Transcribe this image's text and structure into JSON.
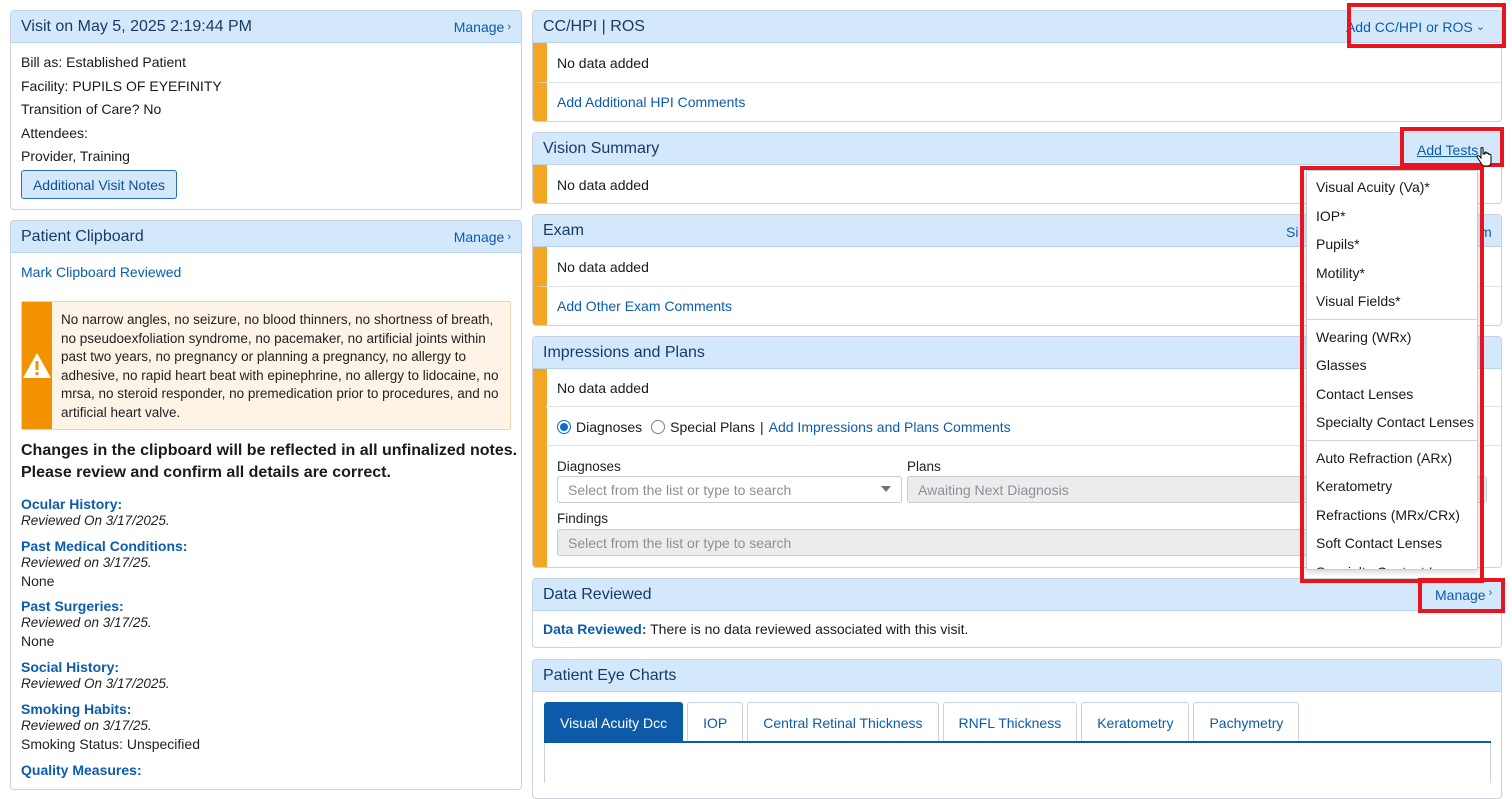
{
  "visit": {
    "title": "Visit on May 5, 2025 2:19:44 PM",
    "manage": "Manage",
    "bill_as": "Bill as: Established Patient",
    "facility": "Facility: PUPILS OF EYEFINITY",
    "transition": "Transition of Care? No",
    "attendees_label": "Attendees:",
    "attendees": "Provider, Training",
    "notes_button": "Additional Visit Notes"
  },
  "clipboard": {
    "title": "Patient Clipboard",
    "manage": "Manage",
    "mark_reviewed": "Mark Clipboard Reviewed",
    "alert": "No narrow angles, no seizure, no blood thinners, no shortness of breath, no pseudoexfoliation syndrome, no pacemaker, no artificial joints within past two years, no pregnancy or planning a pregnancy, no allergy to adhesive, no rapid heart beat with epinephrine, no allergy to lidocaine, no mrsa, no steroid responder, no premedication prior to procedures, and no artificial heart valve.",
    "notice_line1": "Changes in the clipboard will be reflected in all unfinalized notes.",
    "notice_line2": "Please review and confirm all details are correct.",
    "history": [
      {
        "title": "Ocular History:",
        "reviewed": "Reviewed On 3/17/2025.",
        "value": ""
      },
      {
        "title": "Past Medical Conditions:",
        "reviewed": "Reviewed on 3/17/25.",
        "value": "None"
      },
      {
        "title": "Past Surgeries:",
        "reviewed": "Reviewed on 3/17/25.",
        "value": "None"
      },
      {
        "title": "Social History:",
        "reviewed": "Reviewed On 3/17/2025.",
        "value": ""
      },
      {
        "title": "Smoking Habits:",
        "reviewed": "Reviewed on 3/17/25.",
        "value": "Smoking Status: Unspecified"
      },
      {
        "title": "Quality Measures:",
        "reviewed": "",
        "value": ""
      }
    ]
  },
  "cc": {
    "title": "CC/HPI | ROS",
    "add": "Add CC/HPI or ROS",
    "no_data": "No data added",
    "comments": "Add Additional HPI Comments"
  },
  "vision": {
    "title": "Vision Summary",
    "add": "Add Tests",
    "no_data": "No data added"
  },
  "exam": {
    "title": "Exam",
    "right_left": "Si",
    "right_right": "m",
    "no_data": "No data added",
    "comments": "Add Other Exam Comments"
  },
  "impressions": {
    "title": "Impressions and Plans",
    "no_data": "No data added",
    "radio_diagnoses": "Diagnoses",
    "radio_special": "Special Plans",
    "sep": "|",
    "comments": "Add Impressions and Plans Comments",
    "diagnoses_label": "Diagnoses",
    "diagnoses_placeholder": "Select from the list or type to search",
    "plans_label": "Plans",
    "plans_placeholder": "Awaiting Next Diagnosis",
    "findings_label": "Findings",
    "findings_placeholder": "Select from the list or type to search"
  },
  "data_reviewed": {
    "title": "Data Reviewed",
    "manage": "Manage",
    "label": "Data Reviewed:",
    "text": " There is no data reviewed associated with this visit."
  },
  "eye_charts": {
    "title": "Patient Eye Charts",
    "tabs": [
      "Visual Acuity Dcc",
      "IOP",
      "Central Retinal Thickness",
      "RNFL Thickness",
      "Keratometry",
      "Pachymetry"
    ]
  },
  "dropdown": {
    "group1": [
      "Visual Acuity (Va)*",
      "IOP*",
      "Pupils*",
      "Motility*",
      "Visual Fields*"
    ],
    "group2": [
      "Wearing (WRx)",
      "Glasses",
      "Contact Lenses",
      "Specialty Contact Lenses"
    ],
    "group3": [
      "Auto Refraction (ARx)",
      "Keratometry",
      "Refractions (MRx/CRx)",
      "Soft Contact Lenses",
      "Specialty Contact L..."
    ]
  },
  "colors": {
    "accent": "#f2a623",
    "header_bg": "#d4e8fb",
    "link": "#0b5cad",
    "highlight": "#e8141e",
    "warning": "#f39200"
  }
}
